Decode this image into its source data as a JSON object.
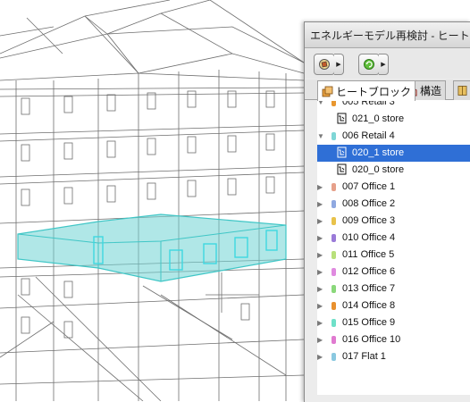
{
  "panel": {
    "title": "エネルギーモデル再検討 - ヒート",
    "toolbar": {
      "view_icon": "model-view-icon",
      "refresh_icon": "refresh-icon"
    },
    "tabs": [
      {
        "label": "ヒートブロック",
        "icon": "heatblock-icon",
        "active": true
      },
      {
        "label": "構造",
        "icon": "structure-icon",
        "active": false
      },
      {
        "label": "",
        "icon": "openings-icon",
        "active": false
      }
    ],
    "tree": [
      {
        "kind": "group",
        "label": "005 Retail 3",
        "expanded": true,
        "color": "#e8962e"
      },
      {
        "kind": "child",
        "label": "021_0 store",
        "selected": false
      },
      {
        "kind": "group",
        "label": "006 Retail 4",
        "expanded": true,
        "color": "#7fd6d6"
      },
      {
        "kind": "child",
        "label": "020_1 store",
        "selected": true
      },
      {
        "kind": "child",
        "label": "020_0 store",
        "selected": false
      },
      {
        "kind": "group",
        "label": "007 Office 1",
        "expanded": false,
        "color": "#e6a08a"
      },
      {
        "kind": "group",
        "label": "008 Office 2",
        "expanded": false,
        "color": "#8fa8e0"
      },
      {
        "kind": "group",
        "label": "009 Office 3",
        "expanded": false,
        "color": "#e8c24a"
      },
      {
        "kind": "group",
        "label": "010 Office 4",
        "expanded": false,
        "color": "#9a7ad8"
      },
      {
        "kind": "group",
        "label": "011 Office 5",
        "expanded": false,
        "color": "#b8e07a"
      },
      {
        "kind": "group",
        "label": "012 Office 6",
        "expanded": false,
        "color": "#e08ae0"
      },
      {
        "kind": "group",
        "label": "013 Office 7",
        "expanded": false,
        "color": "#8ad87a"
      },
      {
        "kind": "group",
        "label": "014 Office 8",
        "expanded": false,
        "color": "#e8902e"
      },
      {
        "kind": "group",
        "label": "015 Office 9",
        "expanded": false,
        "color": "#6fe0c8"
      },
      {
        "kind": "group",
        "label": "016 Office 10",
        "expanded": false,
        "color": "#e07ad0"
      },
      {
        "kind": "group",
        "label": "017 Flat 1",
        "expanded": false,
        "color": "#8ac8e0"
      }
    ]
  },
  "viewport": {
    "highlight_color": "#6fd4d4"
  }
}
